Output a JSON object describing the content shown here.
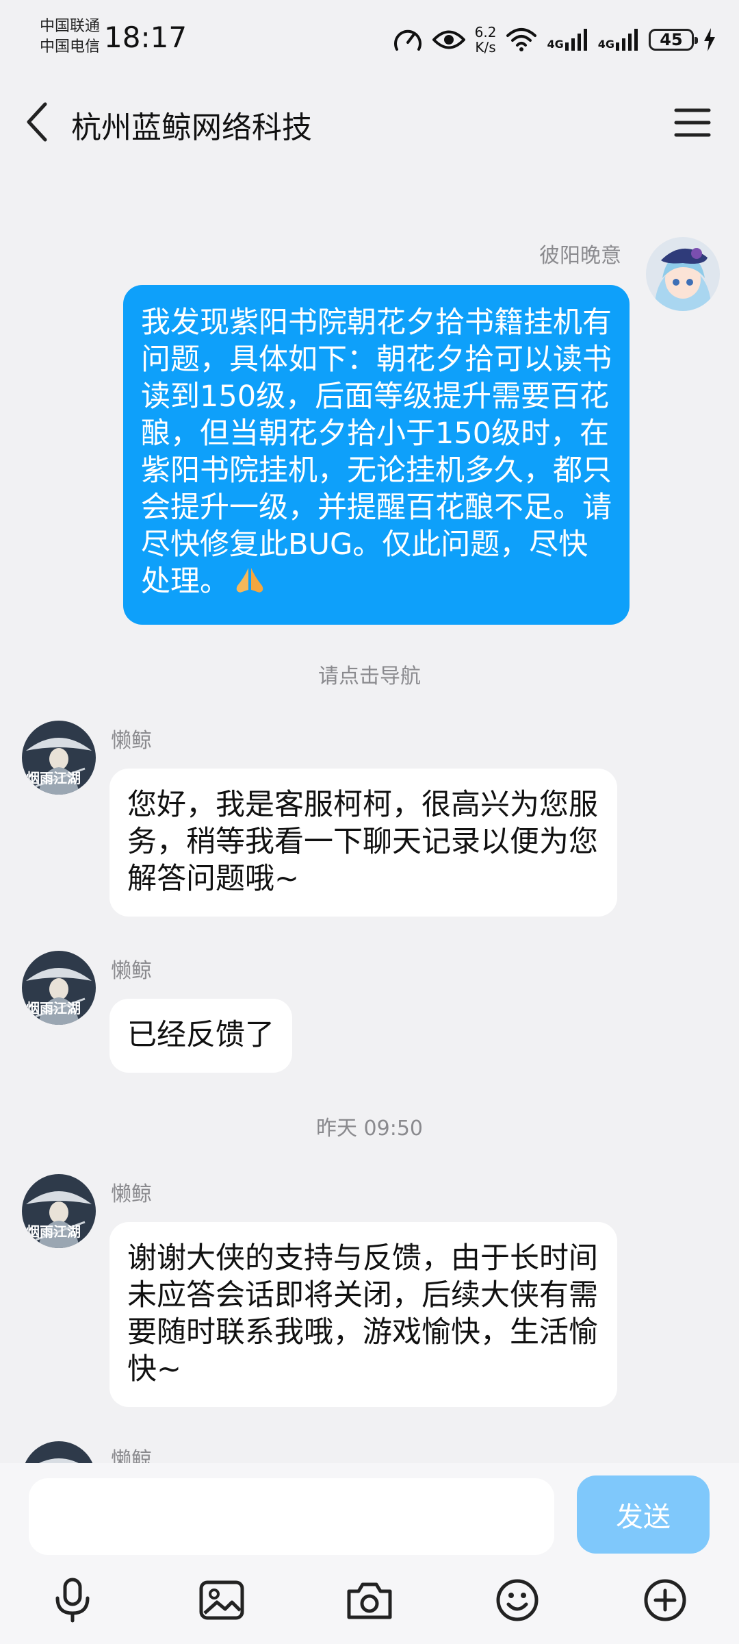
{
  "status_bar": {
    "carrier_1": "中国联通",
    "carrier_2": "中国电信",
    "time": "18:17",
    "net_speed_value": "6.2",
    "net_speed_unit": "K/s",
    "signal_1_label": "4G",
    "signal_2_label": "4G",
    "battery": "45"
  },
  "header": {
    "title": "杭州蓝鲸网络科技"
  },
  "messages": {
    "m1": {
      "sender": "彼阳晚意",
      "text": "我发现紫阳书院朝花夕拾书籍挂机有问题，具体如下：朝花夕拾可以读书读到150级，后面等级提升需要百花酿，但当朝花夕拾小于150级时，在紫阳书院挂机，无论挂机多久，都只会提升一级，并提醒百花酿不足。请尽快修复此BUG。仅此问题，尽快处理。"
    },
    "nav_hint": "请点击导航",
    "m2": {
      "sender": "懒鲸",
      "text": "您好，我是客服柯柯，很高兴为您服务，稍等我看一下聊天记录以便为您解答问题哦~"
    },
    "m3": {
      "sender": "懒鲸",
      "text": "已经反馈了"
    },
    "timestamp": "昨天 09:50",
    "m4": {
      "sender": "懒鲸",
      "text": "谢谢大侠的支持与反馈，由于长时间未应答会话即将关闭，后续大侠有需要随时联系我哦，游戏愉快，生活愉快~"
    },
    "m5": {
      "sender": "懒鲸"
    }
  },
  "composer": {
    "input_value": "",
    "send_label": "发送"
  },
  "avatar_art_text": "烟雨江湖",
  "icons": {
    "back": "chevron-left-icon",
    "menu": "hamburger-menu-icon",
    "voice": "microphone-icon",
    "image": "image-icon",
    "camera": "camera-icon",
    "emoji": "smiley-icon",
    "more": "plus-circle-icon"
  },
  "colors": {
    "my_bubble": "#0ea0fa",
    "send_button": "#7fc8fb",
    "background": "#f1f1f3"
  }
}
